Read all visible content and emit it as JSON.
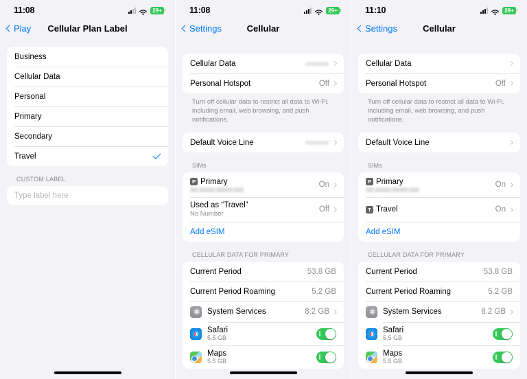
{
  "screens": [
    {
      "id": "cellular-plan-label",
      "status_bar": {
        "time": "11:08",
        "signal_bars": 2,
        "wifi": "wifi-icon",
        "battery_text": "29+",
        "battery_color": "#34c759"
      },
      "nav": {
        "back_label": "Play",
        "title": "Cellular Plan Label"
      },
      "label_options": [
        {
          "label": "Business",
          "selected": false
        },
        {
          "label": "Cellular Data",
          "selected": false
        },
        {
          "label": "Personal",
          "selected": false
        },
        {
          "label": "Primary",
          "selected": false
        },
        {
          "label": "Secondary",
          "selected": false
        },
        {
          "label": "Travel",
          "selected": true
        }
      ],
      "custom_label": {
        "header": "CUSTOM LABEL",
        "placeholder": "Type label here",
        "value": ""
      }
    },
    {
      "id": "cellular-settings-travel-off",
      "status_bar": {
        "time": "11:08",
        "signal_bars": 3,
        "wifi": "wifi-icon",
        "battery_text": "29+",
        "battery_color": "#34c759"
      },
      "nav": {
        "back_label": "Settings",
        "title": "Cellular"
      },
      "top_rows": [
        {
          "label": "Cellular Data",
          "value": "",
          "blurred_value": true,
          "chevron": true
        },
        {
          "label": "Personal Hotspot",
          "value": "Off",
          "blurred_value": false,
          "chevron": true
        }
      ],
      "footnote": "Turn off cellular data to restrict all data to Wi-Fi, including email, web browsing, and push notifications.",
      "voice_rows": [
        {
          "label": "Default Voice Line",
          "value": "",
          "blurred_value": true,
          "chevron": true
        }
      ],
      "sims_header": "SIMs",
      "sims": [
        {
          "badge": "P",
          "title": "Primary",
          "subtitle": "",
          "blurred_number": true,
          "value": "On",
          "chevron": true
        },
        {
          "badge": "",
          "title": "Used as “Travel”",
          "subtitle": "No Number",
          "blurred_number": false,
          "value": "Off",
          "chevron": true
        }
      ],
      "add_esim": "Add eSIM",
      "data_header": "CELLULAR DATA FOR PRIMARY",
      "usage_rows": [
        {
          "label": "Current Period",
          "value": "53.8 GB"
        },
        {
          "label": "Current Period Roaming",
          "value": "5.2 GB"
        }
      ],
      "app_rows": [
        {
          "icon": "gear-icon",
          "name": "System Services",
          "size": "",
          "value": "8.2 GB",
          "control": "chevron"
        },
        {
          "icon": "safari-icon",
          "name": "Safari",
          "size": "5.5 GB",
          "value": "",
          "control": "toggle-on"
        },
        {
          "icon": "maps-icon",
          "name": "Maps",
          "size": "5.5 GB",
          "value": "",
          "control": "toggle-on"
        }
      ]
    },
    {
      "id": "cellular-settings-travel-on",
      "status_bar": {
        "time": "11:10",
        "signal_bars": 3,
        "wifi": "wifi-icon",
        "battery_text": "28+",
        "battery_color": "#34c759"
      },
      "nav": {
        "back_label": "Settings",
        "title": "Cellular"
      },
      "top_rows": [
        {
          "label": "Cellular Data",
          "value": "",
          "blurred_value": false,
          "chevron": true
        },
        {
          "label": "Personal Hotspot",
          "value": "Off",
          "blurred_value": false,
          "chevron": true
        }
      ],
      "footnote": "Turn off cellular data to restrict all data to Wi-Fi, including email, web browsing, and push notifications.",
      "voice_rows": [
        {
          "label": "Default Voice Line",
          "value": "",
          "blurred_value": false,
          "chevron": true
        }
      ],
      "sims_header": "SIMs",
      "sims": [
        {
          "badge": "P",
          "title": "Primary",
          "subtitle": "",
          "blurred_number": true,
          "value": "On",
          "chevron": true
        },
        {
          "badge": "T",
          "title": "Travel",
          "subtitle": "",
          "blurred_number": false,
          "value": "On",
          "chevron": true
        }
      ],
      "add_esim": "Add eSIM",
      "data_header": "CELLULAR DATA FOR PRIMARY",
      "usage_rows": [
        {
          "label": "Current Period",
          "value": "53.8 GB"
        },
        {
          "label": "Current Period Roaming",
          "value": "5.2 GB"
        }
      ],
      "app_rows": [
        {
          "icon": "gear-icon",
          "name": "System Services",
          "size": "",
          "value": "8.2 GB",
          "control": "chevron"
        },
        {
          "icon": "safari-icon",
          "name": "Safari",
          "size": "5.5 GB",
          "value": "",
          "control": "toggle-on"
        },
        {
          "icon": "maps-icon",
          "name": "Maps",
          "size": "5.5 GB",
          "value": "",
          "control": "toggle-on"
        }
      ]
    }
  ],
  "colors": {
    "accent": "#007aff",
    "toggle_on": "#34c759",
    "secondary_text": "#8e8e93",
    "group_bg": "#ffffff",
    "page_bg": "#f2f2f7"
  }
}
